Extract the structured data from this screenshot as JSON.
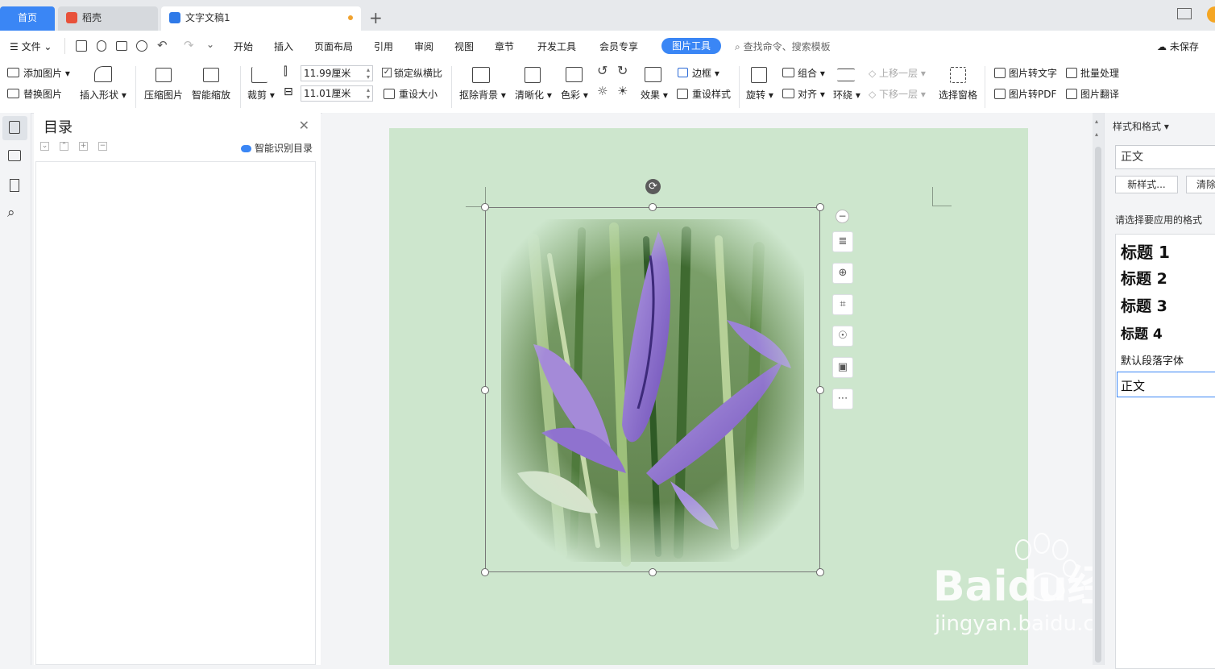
{
  "tabs": {
    "home": "首页",
    "daoke": "稻壳",
    "doc": "文字文稿1",
    "new": "+"
  },
  "menu": {
    "file": "文件",
    "items": [
      "开始",
      "插入",
      "页面布局",
      "引用",
      "审阅",
      "视图",
      "章节",
      "开发工具",
      "会员专享"
    ],
    "active": "图片工具",
    "search": "查找命令、搜索模板",
    "unsaved": "未保存"
  },
  "ribbon": {
    "add_picture": "添加图片",
    "replace_picture": "替换图片",
    "insert_shape": "插入形状",
    "compress": "压缩图片",
    "smart_zoom": "智能缩放",
    "crop": "裁剪",
    "width": "11.99厘米",
    "height": "11.01厘米",
    "lock_ratio": "锁定纵横比",
    "reset_size": "重设大小",
    "remove_bg": "抠除背景",
    "sharpen": "清晰化",
    "color": "色彩",
    "effects": "效果",
    "border": "边框",
    "reset_style": "重设样式",
    "rotate": "旋转",
    "group": "组合",
    "align": "对齐",
    "wrap": "环绕",
    "bring_forward": "上移一层",
    "send_backward": "下移一层",
    "select_pane": "选择窗格",
    "pic_to_text": "图片转文字",
    "batch": "批量处理",
    "pic_to_pdf": "图片转PDF",
    "pic_translate": "图片翻译"
  },
  "toc": {
    "title": "目录",
    "smart": "智能识别目录"
  },
  "styles": {
    "title": "样式和格式",
    "current": "正文",
    "new_style": "新样式...",
    "clear": "清除",
    "hint": "请选择要应用的格式",
    "list": [
      "标题 1",
      "标题 2",
      "标题 3",
      "标题 4",
      "默认段落字体",
      "正文"
    ]
  },
  "watermark": {
    "brand": "Baidu经验",
    "url": "jingyan.baidu.com"
  },
  "colors": {
    "accent": "#3a86f5",
    "page": "#cde6cd",
    "unsaved_dot": "#f0a22e"
  }
}
